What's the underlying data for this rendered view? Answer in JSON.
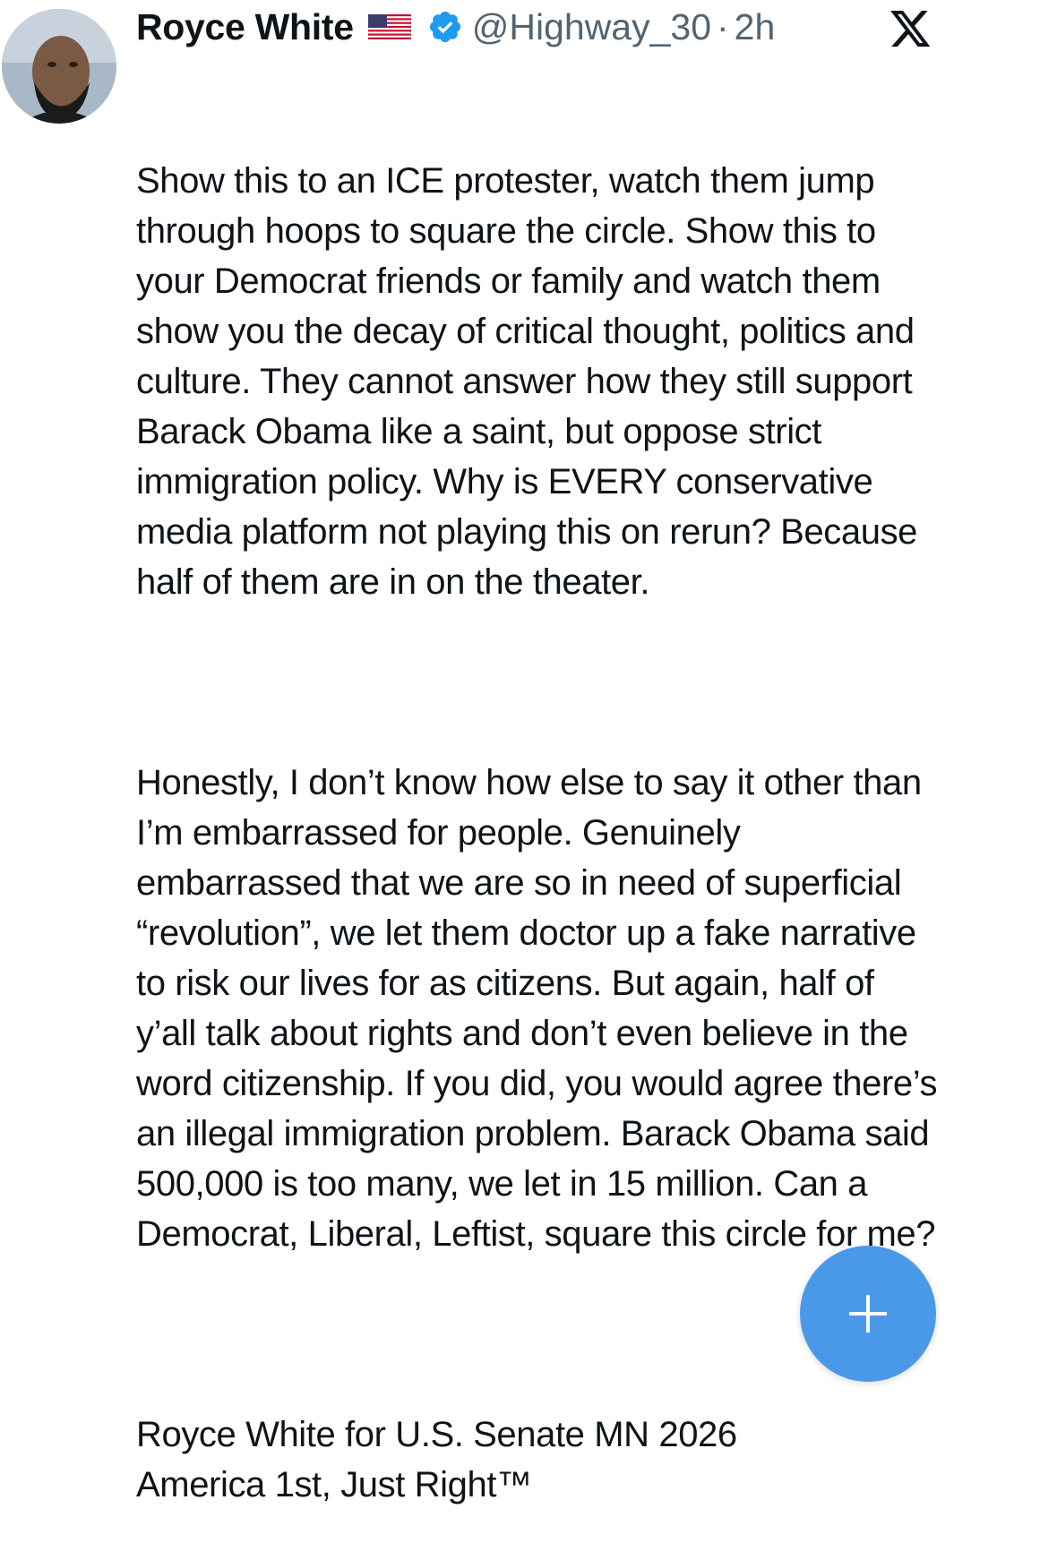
{
  "author": {
    "name": "Royce White",
    "flag_icon": "us-flag-icon",
    "verified_icon": "verified-badge-icon",
    "handle": "@Highway_30",
    "separator": "·",
    "time": "2h"
  },
  "app": {
    "logo_icon": "x-logo-icon"
  },
  "tweet": {
    "paragraphs": [
      "Show this to an ICE protester, watch them jump through hoops to square the circle. Show this to your Democrat friends or family and watch them show you the decay of critical thought, politics and culture. They cannot answer how they still support Barack Obama like a saint, but oppose strict immigration policy. Why is EVERY conservative media platform not playing this on rerun? Because half of them are in on the theater.",
      "Honestly, I don’t know how else to say it other than I’m embarrassed for people. Genuinely embarrassed that we are so in need of superficial “revolution”, we let them doctor up a fake narrative to risk our lives for as citizens. But again, half of y’all talk about rights and don’t even believe in the word citizenship. If you did, you would agree there’s an illegal immigration problem. Barack Obama said 500,000 is too many, we let in 15 million. Can a Democrat, Liberal, Leftist, square this circle for me?",
      "Royce White for U.S. Senate MN 2026\nAmerica 1st, Just Right™"
    ]
  },
  "compose": {
    "icon": "plus-icon"
  },
  "colors": {
    "text": "#0f1419",
    "secondary_text": "#536471",
    "verified_blue": "#1d9bf0",
    "fab_blue": "#4a99e9"
  }
}
